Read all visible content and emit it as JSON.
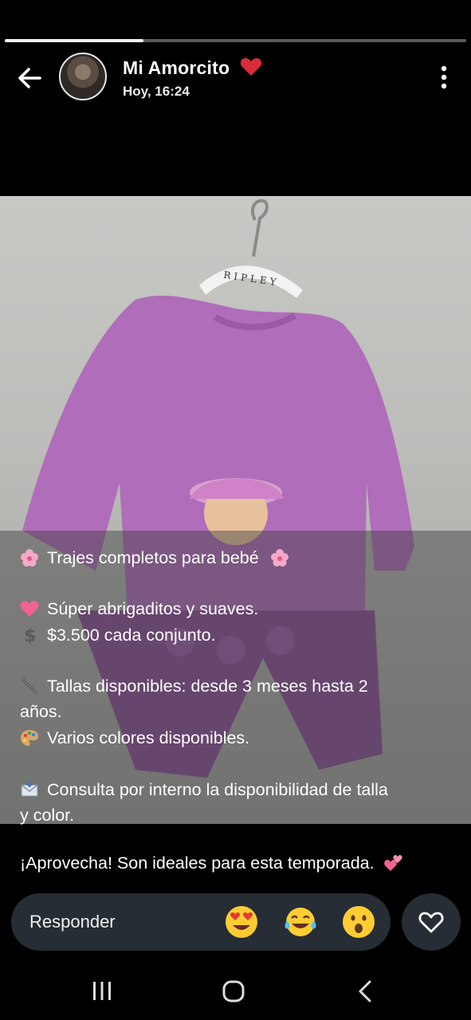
{
  "story": {
    "progress": 0.3
  },
  "header": {
    "user_name": "Mi Amorcito",
    "time": "Hoy, 16:24"
  },
  "photo": {
    "hanger_brand": "RIPLEY"
  },
  "caption": {
    "line1": "Trajes completos para bebé",
    "line2": "Súper abrigaditos y suaves.",
    "line3": "$3.500 cada conjunto.",
    "line4": "Tallas disponibles: desde 3 meses hasta 2",
    "line4b": "años.",
    "line5": "Varios colores disponibles.",
    "line6": "Consulta por interno la disponibilidad de talla",
    "line6b": "y color.",
    "line7": "¡Aprovecha! Son ideales para esta temporada."
  },
  "reply": {
    "placeholder": "Responder"
  },
  "icons": [
    "back-arrow-icon",
    "heart-icon",
    "more-vert-icon",
    "flower-icon",
    "pink-heart-icon",
    "dollar-icon",
    "ruler-icon",
    "palette-icon",
    "envelope-icon",
    "two-hearts-icon",
    "heart-eyes-emoji",
    "tears-of-joy-emoji",
    "surprised-emoji",
    "like-heart-icon",
    "recents-icon",
    "home-icon",
    "nav-back-icon"
  ],
  "colors": {
    "accent_red": "#d92b3a",
    "pink_emoji": "#f06292",
    "bar_bg": "#262d34"
  }
}
